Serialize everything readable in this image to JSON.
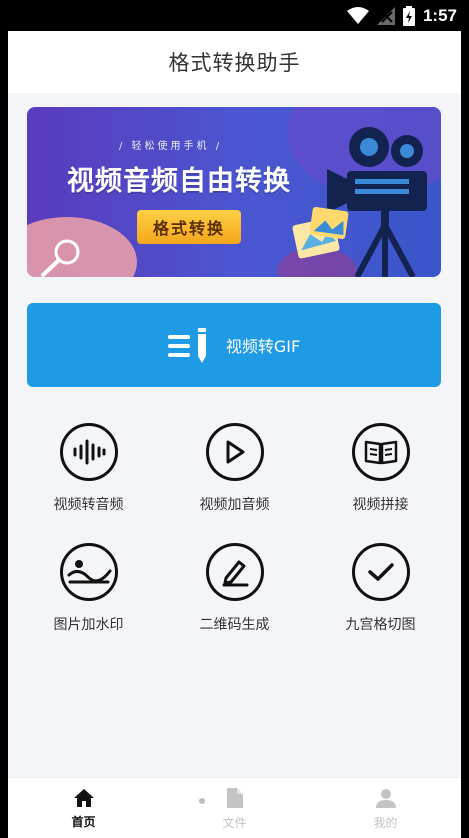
{
  "status_bar": {
    "time": "1:57"
  },
  "header": {
    "title": "格式转换助手"
  },
  "banner": {
    "subtitle": "/ 轻松使用手机 /",
    "title": "视频音频自由转换",
    "button_label": "格式转换"
  },
  "main_action": {
    "label": "视频转GIF",
    "icon": "list-pen-icon"
  },
  "tools": [
    {
      "label": "视频转音频",
      "icon": "audio-wave-icon"
    },
    {
      "label": "视频加音频",
      "icon": "play-icon"
    },
    {
      "label": "视频拼接",
      "icon": "book-icon"
    },
    {
      "label": "图片加水印",
      "icon": "image-icon"
    },
    {
      "label": "二维码生成",
      "icon": "pen-icon"
    },
    {
      "label": "九宫格切图",
      "icon": "check-icon"
    }
  ],
  "tabs": [
    {
      "label": "首页",
      "icon": "home-icon",
      "active": true
    },
    {
      "label": "文件",
      "icon": "file-icon",
      "active": false
    },
    {
      "label": "我的",
      "icon": "user-icon",
      "active": false
    }
  ],
  "colors": {
    "primary_blue": "#1f9be6",
    "banner_purple": "#5a3bbd",
    "banner_button": "#f3a61c",
    "background": "#f4f5f9"
  }
}
